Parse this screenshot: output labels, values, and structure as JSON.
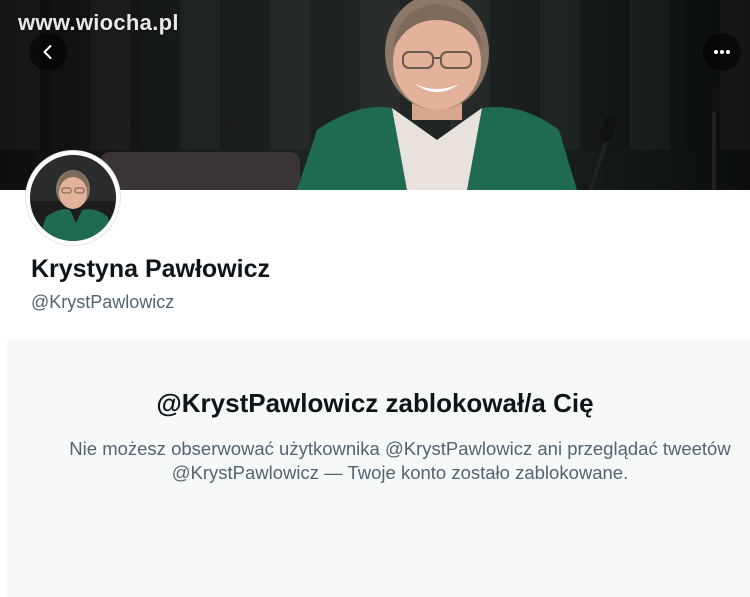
{
  "watermark": "www.wiocha.pl",
  "header": {
    "back_icon": "chevron-left-icon",
    "more_icon": "more-horizontal-icon"
  },
  "profile": {
    "display_name": "Krystyna Pawłowicz",
    "username": "@KrystPawlowicz"
  },
  "blocked": {
    "title": "@KrystPawlowicz zablokował/a Cię",
    "description": "Nie możesz obserwować użytkownika @KrystPawlowicz ani przeglądać tweetów @KrystPawlowicz — Twoje konto zostało zablokowane."
  },
  "colors": {
    "text_primary": "#0f1419",
    "text_secondary": "#536471",
    "blocked_bg": "#f7f9f9",
    "jacket": "#1f6b52"
  }
}
